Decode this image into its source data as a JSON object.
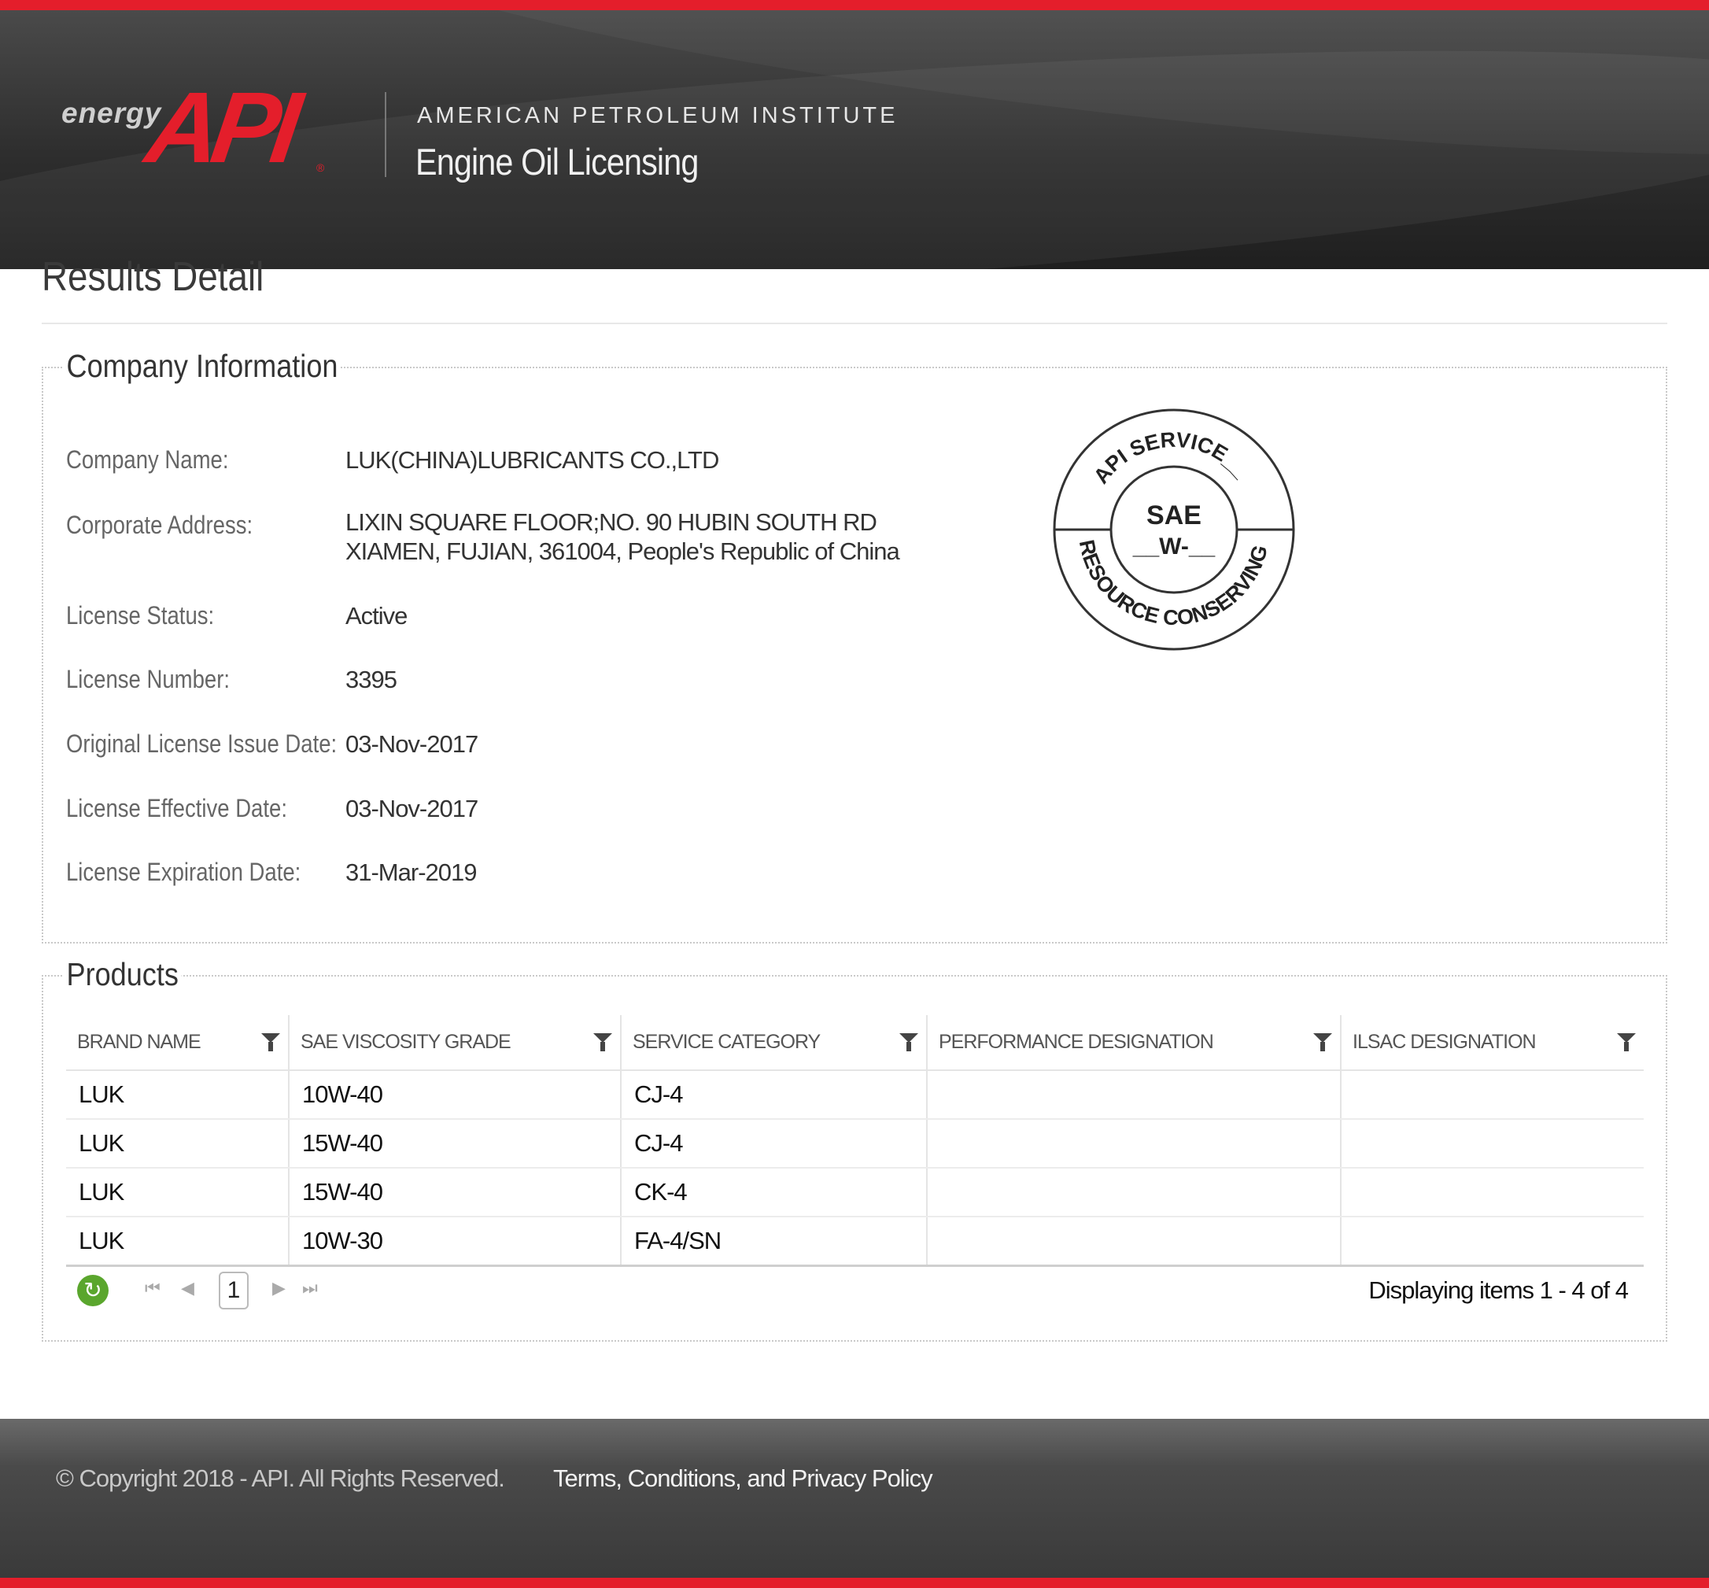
{
  "header": {
    "logo_energy": "energy",
    "logo_api": "API",
    "logo_reg": "®",
    "institute": "AMERICAN PETROLEUM INSTITUTE",
    "subtitle": "Engine Oil Licensing"
  },
  "page_title": "Results Detail",
  "company": {
    "legend": "Company Information",
    "fields": [
      {
        "label": "Company Name:",
        "value": "LUK(CHINA)LUBRICANTS CO.,LTD"
      },
      {
        "label": "Corporate Address:",
        "value": "LIXIN SQUARE FLOOR;NO. 90 HUBIN SOUTH RD",
        "value2": "XIAMEN, FUJIAN, 361004, People's Republic of China"
      },
      {
        "label": "License Status:",
        "value": "Active"
      },
      {
        "label": "License Number:",
        "value": "3395"
      },
      {
        "label": "Original License Issue Date:",
        "value": "03-Nov-2017"
      },
      {
        "label": "License Effective Date:",
        "value": "03-Nov-2017"
      },
      {
        "label": "License Expiration Date:",
        "value": "31-Mar-2019"
      }
    ],
    "seal": {
      "top": "API SERVICE__",
      "center1": "SAE",
      "center2": "__W-__",
      "bottom": "RESOURCE CONSERVING"
    }
  },
  "products": {
    "legend": "Products",
    "columns": [
      "BRAND NAME",
      "SAE VISCOSITY GRADE",
      "SERVICE CATEGORY",
      "PERFORMANCE DESIGNATION",
      "ILSAC DESIGNATION"
    ],
    "rows": [
      [
        "LUK",
        "10W-40",
        "CJ-4",
        "",
        ""
      ],
      [
        "LUK",
        "15W-40",
        "CJ-4",
        "",
        ""
      ],
      [
        "LUK",
        "15W-40",
        "CK-4",
        "",
        ""
      ],
      [
        "LUK",
        "10W-30",
        "FA-4/SN",
        "",
        ""
      ]
    ],
    "pager": {
      "refresh_icon": "↻",
      "first_icon": "⏮",
      "prev_icon": "◀",
      "current_page": "1",
      "next_icon": "▶",
      "last_icon": "⏭",
      "info": "Displaying items 1 - 4 of 4"
    }
  },
  "footer": {
    "copyright": "© Copyright 2018 - API. All Rights Reserved.",
    "terms": "Terms, Conditions, and Privacy Policy"
  },
  "colors": {
    "accent_red": "#e41e2b",
    "header_dark": "#2e2e2e",
    "refresh_green": "#5aa62d"
  }
}
